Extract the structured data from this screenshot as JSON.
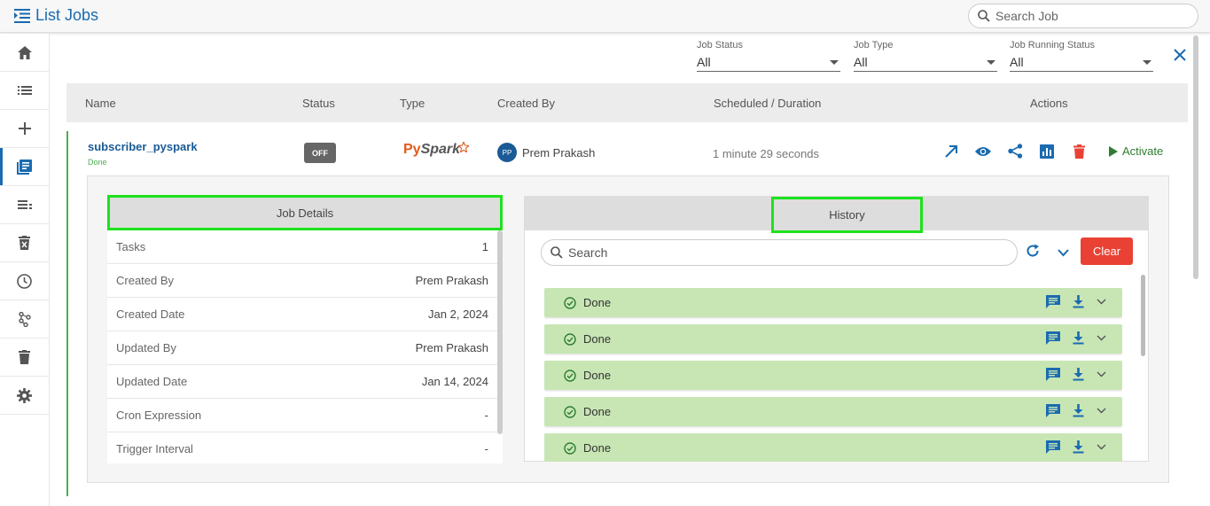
{
  "header": {
    "title": "List Jobs",
    "search_placeholder": "Search Job"
  },
  "sidebar": {
    "items": [
      "home-icon",
      "list-icon",
      "plus-icon",
      "jobs-icon",
      "pipeline-icon",
      "trash-x-icon",
      "clock-icon",
      "flow-icon",
      "delete-icon",
      "gear-icon"
    ],
    "active_index": 3
  },
  "filters": [
    {
      "label": "Job Status",
      "value": "All"
    },
    {
      "label": "Job Type",
      "value": "All"
    },
    {
      "label": "Job Running Status",
      "value": "All"
    }
  ],
  "table": {
    "columns": [
      "Name",
      "Status",
      "Type",
      "Created By",
      "Scheduled / Duration",
      "Actions"
    ]
  },
  "job": {
    "name": "subscriber_pyspark",
    "substatus": "Done",
    "status_badge": "OFF",
    "type_logo_py": "Py",
    "type_logo_spark": "Spark",
    "avatar_initials": "PP",
    "created_by": "Prem Prakash",
    "duration": "1 minute 29 seconds",
    "activate_label": "Activate"
  },
  "job_details": {
    "title": "Job Details",
    "rows": [
      {
        "label": "Tasks",
        "value": "1"
      },
      {
        "label": "Created By",
        "value": "Prem Prakash"
      },
      {
        "label": "Created Date",
        "value": "Jan 2, 2024"
      },
      {
        "label": "Updated By",
        "value": "Prem Prakash"
      },
      {
        "label": "Updated Date",
        "value": "Jan 14, 2024"
      },
      {
        "label": "Cron Expression",
        "value": "-"
      },
      {
        "label": "Trigger Interval",
        "value": "-"
      }
    ]
  },
  "history": {
    "title": "History",
    "search_placeholder": "Search",
    "clear_label": "Clear",
    "items": [
      "Done",
      "Done",
      "Done",
      "Done",
      "Done"
    ]
  },
  "colors": {
    "accent": "#1a6bb0",
    "done_bg": "#c8e6b4",
    "clear": "#e94235",
    "highlight": "#1de21d"
  }
}
